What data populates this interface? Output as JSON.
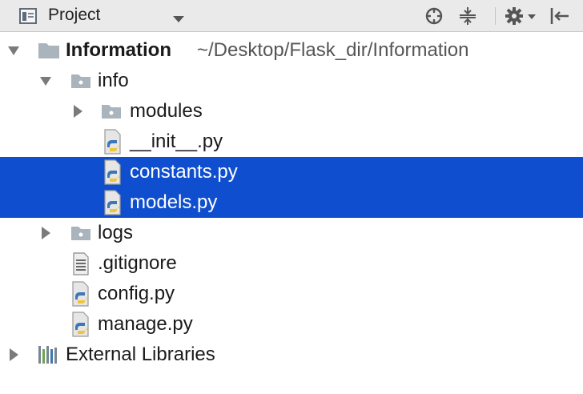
{
  "toolbar": {
    "title": "Project",
    "icons": [
      "project-view-icon",
      "dropdown-caret-icon",
      "locate-icon",
      "collapse-all-icon",
      "settings-gear-icon",
      "hide-panel-icon"
    ]
  },
  "tree": {
    "root": {
      "name": "Information",
      "path": "~/Desktop/Flask_dir/Information"
    },
    "info": {
      "name": "info"
    },
    "modules": {
      "name": "modules"
    },
    "init": {
      "name": "__init__.py"
    },
    "constants": {
      "name": "constants.py"
    },
    "models": {
      "name": "models.py"
    },
    "logs": {
      "name": "logs"
    },
    "gitignore": {
      "name": ".gitignore"
    },
    "config": {
      "name": "config.py"
    },
    "manage": {
      "name": "manage.py"
    },
    "external": {
      "name": "External Libraries"
    }
  },
  "colors": {
    "selection": "#0f4fcf",
    "folder": "#aab4bd",
    "toolbar": "#eaeaea"
  }
}
